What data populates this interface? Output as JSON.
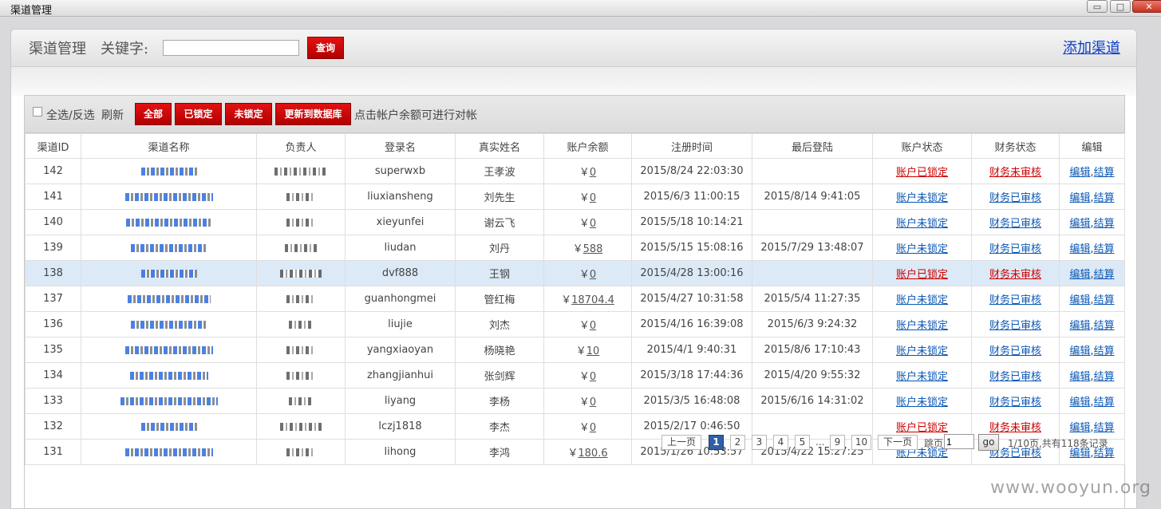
{
  "window": {
    "title": "渠道管理",
    "minimize": "▭",
    "maximize": "□",
    "close": "✕"
  },
  "toolbar": {
    "title": "渠道管理",
    "keyword_label": "关键字:",
    "keyword_value": "",
    "search_label": "查询",
    "add_label": "添加渠道"
  },
  "actions": {
    "select_all": "全选/反选",
    "refresh": "刷新",
    "all": "全部",
    "locked": "已锁定",
    "unlocked": "未锁定",
    "update_db": "更新到数据库",
    "hint": "点击帐户余额可进行对帐"
  },
  "columns": [
    "渠道ID",
    "渠道名称",
    "负责人",
    "登录名",
    "真实姓名",
    "账户余额",
    "注册时间",
    "最后登陆",
    "账户状态",
    "财务状态",
    "编辑"
  ],
  "rows": [
    {
      "id": "142",
      "login": "superwxb",
      "name": "王孝波",
      "balance": "0",
      "reg": "2015/8/24 22:03:30",
      "last": "",
      "account": "账户已锁定",
      "account_red": true,
      "finance": "财务未审核",
      "finance_red": true
    },
    {
      "id": "141",
      "login": "liuxiansheng",
      "name": "刘先生",
      "balance": "0",
      "reg": "2015/6/3 11:00:15",
      "last": "2015/8/14 9:41:05",
      "account": "账户未锁定",
      "account_red": false,
      "finance": "财务已审核",
      "finance_red": false
    },
    {
      "id": "140",
      "login": "xieyunfei",
      "name": "谢云飞",
      "balance": "0",
      "reg": "2015/5/18 10:14:21",
      "last": "",
      "account": "账户未锁定",
      "account_red": false,
      "finance": "财务已审核",
      "finance_red": false
    },
    {
      "id": "139",
      "login": "liudan",
      "name": "刘丹",
      "balance": "588",
      "reg": "2015/5/15 15:08:16",
      "last": "2015/7/29 13:48:07",
      "account": "账户未锁定",
      "account_red": false,
      "finance": "财务已审核",
      "finance_red": false
    },
    {
      "id": "138",
      "login": "dvf888",
      "name": "王钢",
      "balance": "0",
      "reg": "2015/4/28 13:00:16",
      "last": "",
      "account": "账户已锁定",
      "account_red": true,
      "finance": "财务未审核",
      "finance_red": true,
      "selected": true
    },
    {
      "id": "137",
      "login": "guanhongmei",
      "name": "管红梅",
      "balance": "18704.4",
      "reg": "2015/4/27 10:31:58",
      "last": "2015/5/4 11:27:35",
      "account": "账户未锁定",
      "account_red": false,
      "finance": "财务已审核",
      "finance_red": false
    },
    {
      "id": "136",
      "login": "liujie",
      "name": "刘杰",
      "balance": "0",
      "reg": "2015/4/16 16:39:08",
      "last": "2015/6/3 9:24:32",
      "account": "账户未锁定",
      "account_red": false,
      "finance": "财务已审核",
      "finance_red": false
    },
    {
      "id": "135",
      "login": "yangxiaoyan",
      "name": "杨晓艳",
      "balance": "10",
      "reg": "2015/4/1 9:40:31",
      "last": "2015/8/6 17:10:43",
      "account": "账户未锁定",
      "account_red": false,
      "finance": "财务已审核",
      "finance_red": false
    },
    {
      "id": "134",
      "login": "zhangjianhui",
      "name": "张剑辉",
      "balance": "0",
      "reg": "2015/3/18 17:44:36",
      "last": "2015/4/20 9:55:32",
      "account": "账户未锁定",
      "account_red": false,
      "finance": "财务已审核",
      "finance_red": false
    },
    {
      "id": "133",
      "login": "liyang",
      "name": "李杨",
      "balance": "0",
      "reg": "2015/3/5 16:48:08",
      "last": "2015/6/16 14:31:02",
      "account": "账户未锁定",
      "account_red": false,
      "finance": "财务已审核",
      "finance_red": false
    },
    {
      "id": "132",
      "login": "lczj1818",
      "name": "李杰",
      "balance": "0",
      "reg": "2015/2/17 0:46:50",
      "last": "",
      "account": "账户已锁定",
      "account_red": true,
      "finance": "财务未审核",
      "finance_red": true
    },
    {
      "id": "131",
      "login": "lihong",
      "name": "李鸿",
      "balance": "180.6",
      "reg": "2015/1/26 10:53:57",
      "last": "2015/4/22 15:27:25",
      "account": "账户未锁定",
      "account_red": false,
      "finance": "财务已审核",
      "finance_red": false
    }
  ],
  "currency": "￥",
  "edit_label": "编辑",
  "settle_label": "结算",
  "pager": {
    "prev": "上一页",
    "pages": [
      "1",
      "2",
      "3",
      "4",
      "5"
    ],
    "ellipsis": "...",
    "pages_end": [
      "9",
      "10"
    ],
    "next": "下一页",
    "jump_label": "跳页",
    "jump_value": "1",
    "go": "go",
    "summary": "1/10页,共有118条记录"
  },
  "watermark": "www.wooyun.org"
}
